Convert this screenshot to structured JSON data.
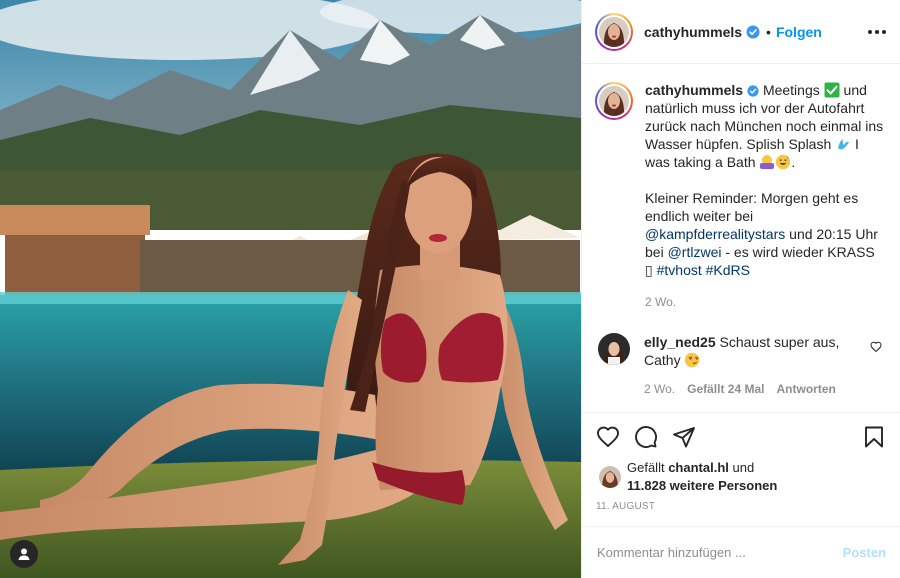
{
  "header": {
    "username": "cathyhummels",
    "separator": "•",
    "follow_label": "Folgen"
  },
  "caption": {
    "username": "cathyhummels",
    "line1_start": "Meetings",
    "line1_end": "und natürlich muss ich vor der Autofahrt zurück nach München noch einmal ins Wasser hüpfen. Splish Splash",
    "line1_tail": "I was taking a Bath",
    "line1_period": ".",
    "line2": "Kleiner Reminder: Morgen geht es endlich weiter bei",
    "mention1": "@kampfderrealitystars",
    "line3": "und 20:15 Uhr bei",
    "mention2": "@rtlzwei",
    "line4": "- es wird wieder KRASS ▯",
    "hashtag1": "#tvhost",
    "hashtag2": "#KdRS",
    "time": "2 Wo."
  },
  "comment": {
    "username": "elly_ned25",
    "text": "Schaust super aus, Cathy",
    "time": "2 Wo.",
    "likes": "Gefällt 24 Mal",
    "reply": "Antworten"
  },
  "likes": {
    "prefix": "Gefällt",
    "user": "chantal.hl",
    "conj": "und",
    "count": "11.828 weitere Personen"
  },
  "date": "11. AUGUST",
  "add_comment": {
    "placeholder": "Kommentar hinzufügen ...",
    "post_label": "Posten"
  },
  "icons": {
    "verified": "verified-badge-icon",
    "more": "more-options-icon",
    "like": "heart-icon",
    "comment": "comment-bubble-icon",
    "share": "paper-plane-icon",
    "save": "bookmark-icon",
    "tag": "user-tag-icon"
  },
  "colors": {
    "link": "#0095f6",
    "mention": "#00376b",
    "muted": "#8e8e8e",
    "post_disabled": "#b2dffc"
  }
}
